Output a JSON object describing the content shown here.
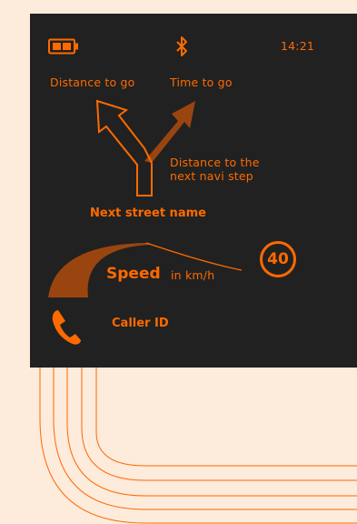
{
  "colors": {
    "background": "#fdebdc",
    "screen": "#212121",
    "accent": "#ff6a00",
    "arc": "#9a4510"
  },
  "status_bar": {
    "battery_icon": "battery-icon",
    "bluetooth_icon": "bluetooth-icon",
    "time": "14:21"
  },
  "navigation": {
    "distance_to_go": "Distance to go",
    "time_to_go": "Time to go",
    "next_step_label_line1": "Distance to the",
    "next_step_label_line2": "next navi step",
    "street_name": "Next street name",
    "arrow_icon": "fork-arrow-icon"
  },
  "speed": {
    "label": "Speed",
    "unit": "in km/h",
    "limit": "40",
    "limit_icon": "speed-limit-sign-icon"
  },
  "call": {
    "phone_icon": "phone-icon",
    "caller_id": "Caller ID"
  }
}
